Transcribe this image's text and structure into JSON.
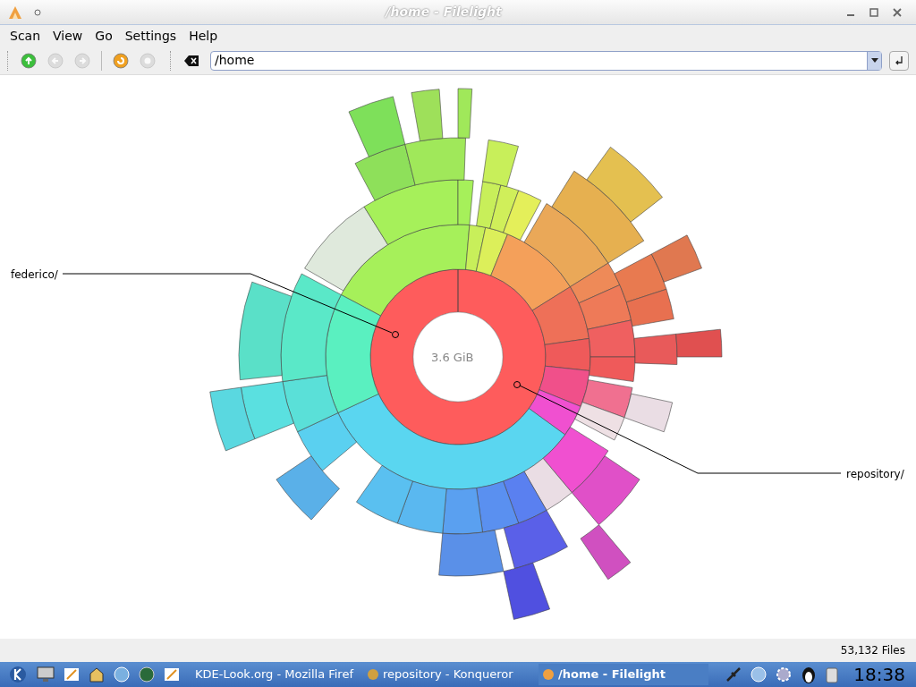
{
  "window": {
    "title": "/home - Filelight"
  },
  "menu": [
    {
      "label": "Scan"
    },
    {
      "label": "View"
    },
    {
      "label": "Go"
    },
    {
      "label": "Settings"
    },
    {
      "label": "Help"
    }
  ],
  "toolbar": [
    {
      "kind": "up",
      "disabled": false
    },
    {
      "kind": "back",
      "disabled": true
    },
    {
      "kind": "forward",
      "disabled": true
    },
    {
      "kind": "rescan",
      "disabled": false
    },
    {
      "kind": "stop",
      "disabled": true
    }
  ],
  "location": {
    "value": "/home"
  },
  "chart": {
    "center_label": "3.6 GiB",
    "labels": [
      {
        "text": "federico/",
        "kind": "left"
      },
      {
        "text": "repository/",
        "kind": "right"
      }
    ]
  },
  "status_bar": {
    "files": "53,132 Files"
  },
  "taskbar": {
    "tasks": [
      {
        "label": "KDE-Look.org - Mozilla Firef",
        "selected": false
      },
      {
        "label": "repository - Konqueror",
        "selected": false
      },
      {
        "label": "/home - Filelight",
        "selected": true
      }
    ],
    "clock": "18:38"
  }
}
